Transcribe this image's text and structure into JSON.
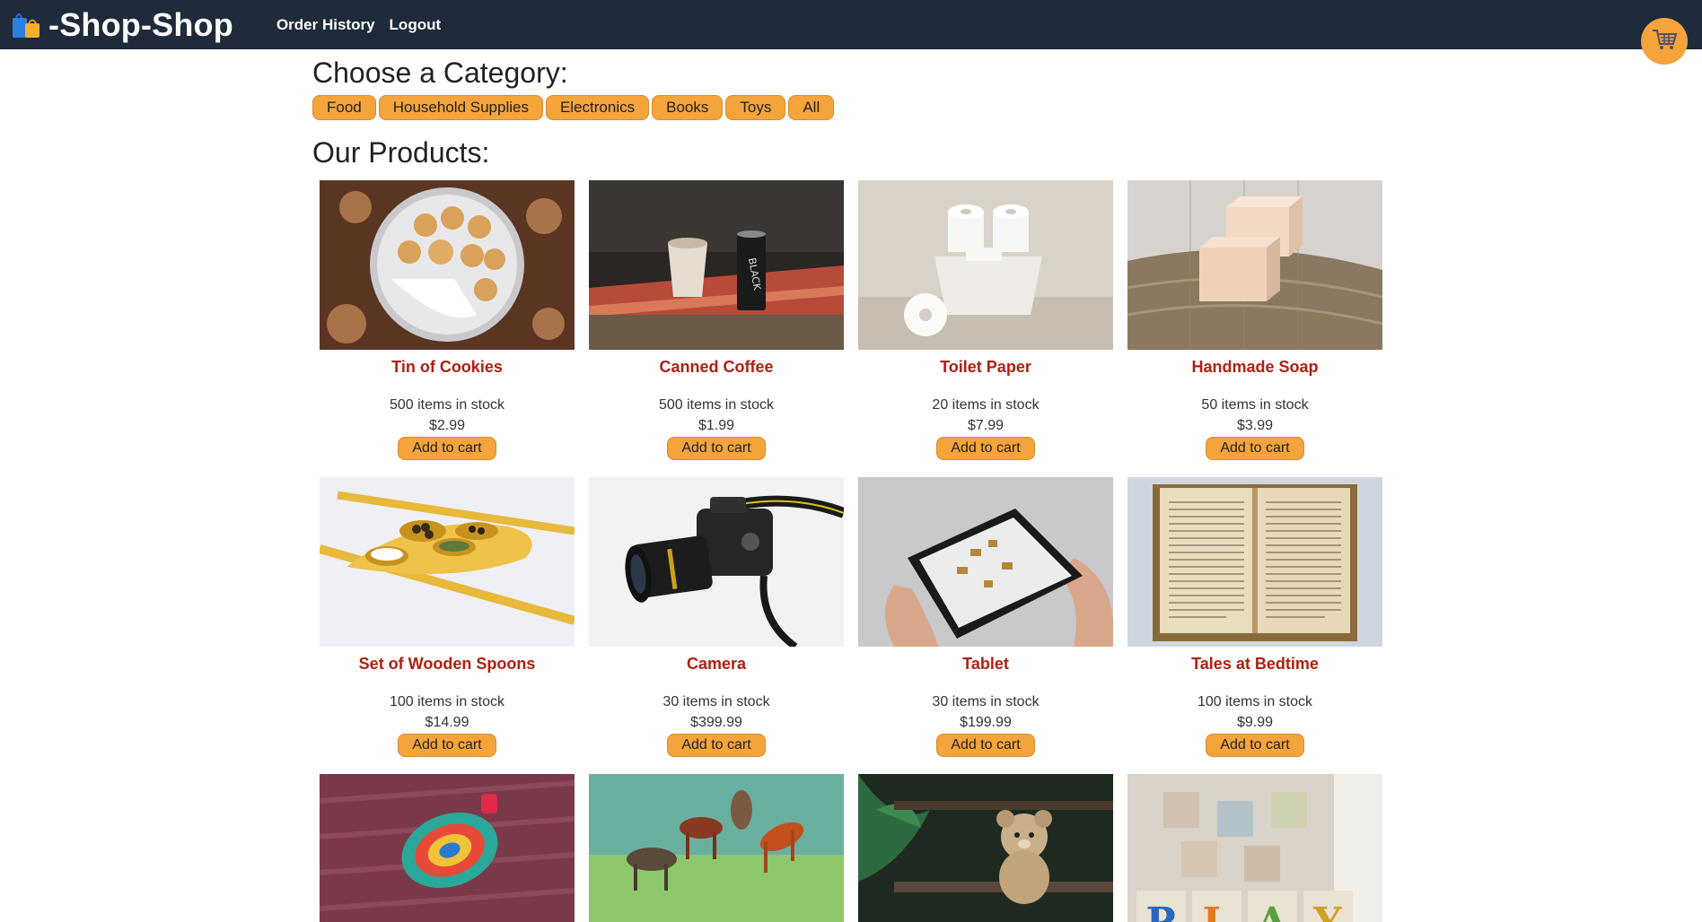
{
  "header": {
    "brand_title": "-Shop-Shop",
    "nav": [
      "Order History",
      "Logout"
    ],
    "cart_icon": "shopping-cart-icon"
  },
  "categories": {
    "heading": "Choose a Category:",
    "items": [
      "Food",
      "Household Supplies",
      "Electronics",
      "Books",
      "Toys",
      "All"
    ]
  },
  "products": {
    "heading": "Our Products:",
    "items": [
      {
        "name": "Tin of Cookies",
        "stock": "500 items in stock",
        "price": "$2.99",
        "button": "Add to cart"
      },
      {
        "name": "Canned Coffee",
        "stock": "500 items in stock",
        "price": "$1.99",
        "button": "Add to cart"
      },
      {
        "name": "Toilet Paper",
        "stock": "20 items in stock",
        "price": "$7.99",
        "button": "Add to cart"
      },
      {
        "name": "Handmade Soap",
        "stock": "50 items in stock",
        "price": "$3.99",
        "button": "Add to cart"
      },
      {
        "name": "Set of Wooden Spoons",
        "stock": "100 items in stock",
        "price": "$14.99",
        "button": "Add to cart"
      },
      {
        "name": "Camera",
        "stock": "30 items in stock",
        "price": "$399.99",
        "button": "Add to cart"
      },
      {
        "name": "Tablet",
        "stock": "30 items in stock",
        "price": "$199.99",
        "button": "Add to cart"
      },
      {
        "name": "Tales at Bedtime",
        "stock": "100 items in stock",
        "price": "$9.99",
        "button": "Add to cart"
      }
    ]
  },
  "colors": {
    "header_bg": "#1f2a3a",
    "accent": "#f4a43a",
    "product_name": "#b01f10"
  }
}
